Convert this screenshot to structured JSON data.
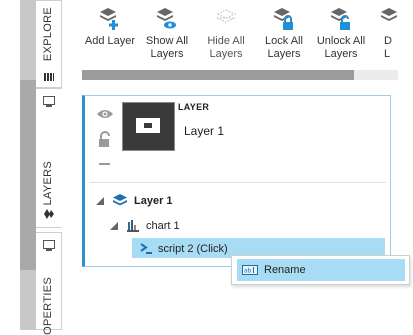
{
  "side_tabs": {
    "explore": "EXPLORE",
    "layers": "LAYERS",
    "properties": "OPERTIES"
  },
  "toolbar": {
    "add_layer": "Add Layer",
    "show_all_layers": "Show All\nLayers",
    "hide_all_layers": "Hide All\nLayers",
    "lock_all_layers": "Lock All\nLayers",
    "unlock_all_layers": "Unlock All\nLayers",
    "cut_off": "D\nL"
  },
  "layer_card": {
    "type_label": "LAYER",
    "name": "Layer 1"
  },
  "tree": {
    "layer": "Layer 1",
    "chart": "chart 1",
    "script": "script 2 (Click)"
  },
  "context_menu": {
    "rename": "Rename"
  },
  "colors": {
    "accent_blue": "#2f8fd1",
    "selection": "#a8dcf4",
    "panel_border": "#9ccde9"
  }
}
